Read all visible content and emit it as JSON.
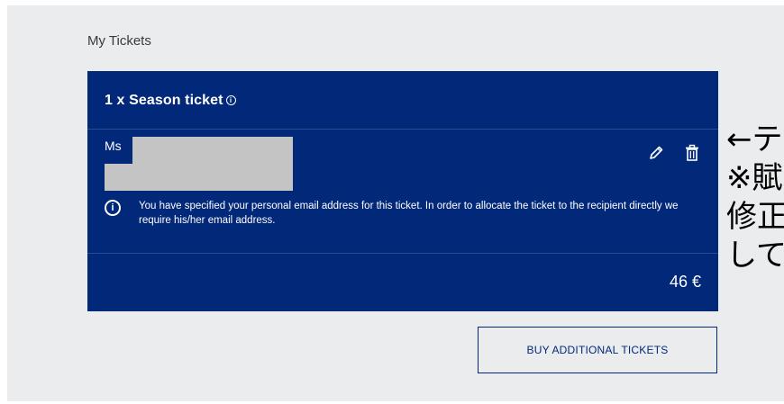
{
  "section": {
    "title": "My Tickets"
  },
  "ticket": {
    "quantity_title": "1 x Season ticket",
    "info_icon": "info-icon",
    "recipient": {
      "salutation": "Ms"
    },
    "actions": {
      "edit_icon": "pencil-icon",
      "delete_icon": "trash-icon"
    },
    "notice": {
      "icon": "info-circle-icon",
      "text": "You have specified your personal email address for this ticket. In order to allocate the ticket to the recipient directly we require his/her email address."
    },
    "price": "46 €"
  },
  "buy_button": {
    "label": "BUY ADDITIONAL TICKETS"
  },
  "annotation": {
    "lines": [
      "←テ",
      "※賦",
      "修正",
      "して"
    ]
  },
  "colors": {
    "card": "#02287a",
    "panel": "#ebecee",
    "redaction": "#c4c4c4"
  }
}
